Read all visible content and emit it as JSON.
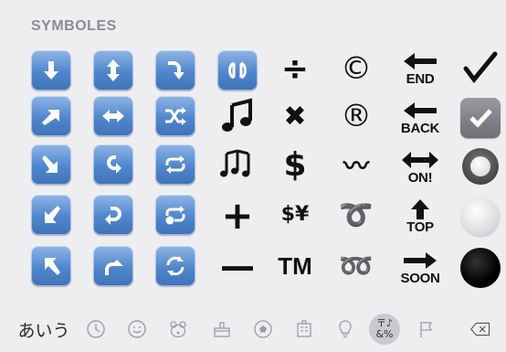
{
  "keyboard": {
    "section_title": "SYMBOLES",
    "symbols": {
      "divide": "÷",
      "multiply": "✖",
      "dollar": "$",
      "plus": "+",
      "minus": "—",
      "currency": "$¥",
      "tm": "TM",
      "copyright": "©",
      "registered": "®",
      "wavy": "〰",
      "curly_loop": "➰",
      "double_loop": "➿",
      "check": "✓"
    },
    "word_arrows": [
      "END",
      "BACK",
      "ON!",
      "TOP",
      "SOON"
    ],
    "colors": {
      "key_blue": "#4f86cc",
      "toolbar_active": "#c9c9cf",
      "background": "#eeeef1"
    }
  },
  "toolbar": {
    "kana_label": "あいう",
    "active_label_top": "〒♪",
    "active_label_bottom": "&%",
    "icons": [
      "clock-icon",
      "smiley-icon",
      "animal-icon",
      "food-icon",
      "ball-icon",
      "building-icon",
      "bulb-icon",
      "symbols-icon",
      "flag-icon",
      "delete-icon"
    ]
  }
}
